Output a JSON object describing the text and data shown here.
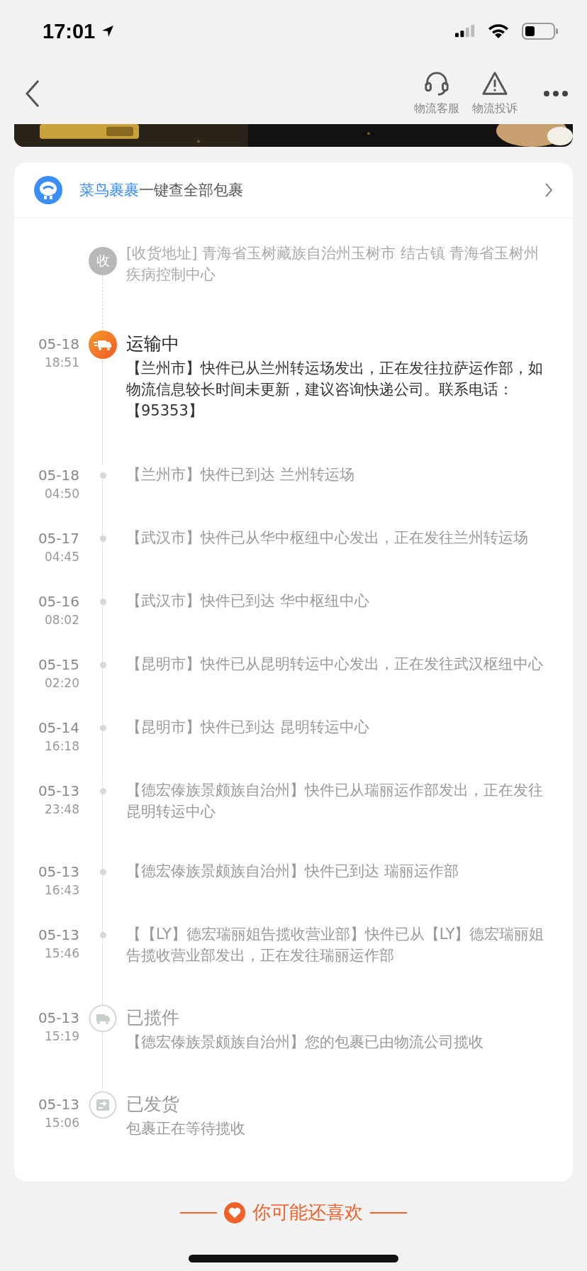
{
  "status_bar": {
    "time": "17:01"
  },
  "nav": {
    "actions": [
      {
        "kind": "service",
        "label": "物流客服"
      },
      {
        "kind": "complain",
        "label": "物流投诉"
      }
    ]
  },
  "header": {
    "brand": "菜鸟裹裹",
    "text": "一键查全部包裹"
  },
  "timeline": [
    {
      "kind": "address",
      "badge": "收",
      "text": "[收货地址] 青海省玉树藏族自治州玉树市  结古镇   青海省玉树州疾病控制中心"
    },
    {
      "kind": "transit",
      "date": "05-18",
      "time": "18:51",
      "title": "运输中",
      "text": "【兰州市】快件已从兰州转运场发出，正在发往拉萨运作部，如物流信息较长时间未更新，建议咨询快递公司。联系电话：【95353】"
    },
    {
      "kind": "update",
      "date": "05-18",
      "time": "04:50",
      "text": "【兰州市】快件已到达 兰州转运场"
    },
    {
      "kind": "update",
      "date": "05-17",
      "time": "04:45",
      "text": "【武汉市】快件已从华中枢纽中心发出，正在发往兰州转运场"
    },
    {
      "kind": "update",
      "date": "05-16",
      "time": "08:02",
      "text": "【武汉市】快件已到达 华中枢纽中心"
    },
    {
      "kind": "update",
      "date": "05-15",
      "time": "02:20",
      "text": "【昆明市】快件已从昆明转运中心发出，正在发往武汉枢纽中心"
    },
    {
      "kind": "update",
      "date": "05-14",
      "time": "16:18",
      "text": "【昆明市】快件已到达 昆明转运中心"
    },
    {
      "kind": "update",
      "date": "05-13",
      "time": "23:48",
      "text": "【德宏傣族景颇族自治州】快件已从瑞丽运作部发出，正在发往昆明转运中心"
    },
    {
      "kind": "update",
      "date": "05-13",
      "time": "16:43",
      "text": "【德宏傣族景颇族自治州】快件已到达 瑞丽运作部"
    },
    {
      "kind": "update",
      "date": "05-13",
      "time": "15:46",
      "text": "【【LY】德宏瑞丽姐告揽收营业部】快件已从【LY】德宏瑞丽姐告揽收营业部发出，正在发往瑞丽运作部"
    },
    {
      "kind": "pickup",
      "date": "05-13",
      "time": "15:19",
      "title": "已揽件",
      "text": "【德宏傣族景颇族自治州】您的包裹已由物流公司揽收"
    },
    {
      "kind": "shipped",
      "date": "05-13",
      "time": "15:06",
      "title": "已发货",
      "text": "包裹正在等待揽收"
    }
  ],
  "recommend": {
    "title": "你可能还喜欢"
  }
}
